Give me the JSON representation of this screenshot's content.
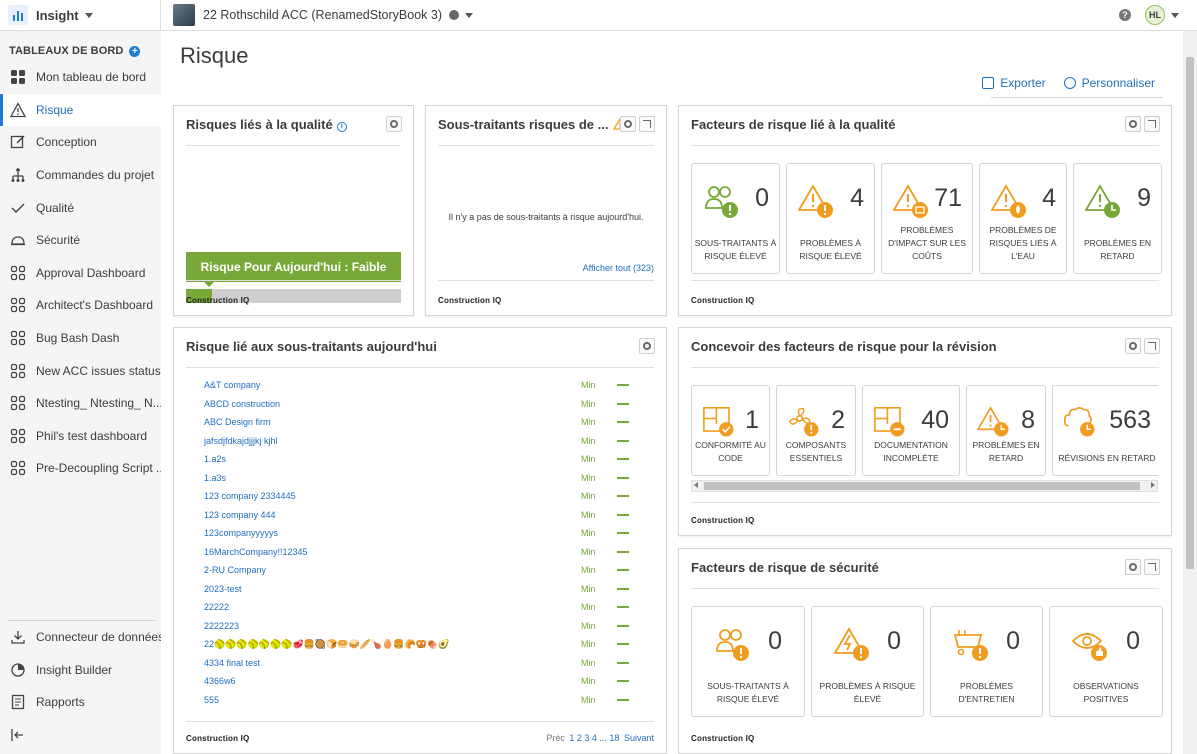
{
  "topbar": {
    "app_name": "Insight",
    "project_name": "22 Rothschild ACC (RenamedStoryBook 3)",
    "help_icon": "?",
    "avatar_initials": "HL"
  },
  "sidebar": {
    "header": "TABLEAUX DE BORD",
    "plus": "+",
    "items": [
      {
        "label": "Mon tableau de bord",
        "icon": "grid-icon"
      },
      {
        "label": "Risque",
        "icon": "warning-icon"
      },
      {
        "label": "Conception",
        "icon": "edit-icon"
      },
      {
        "label": "Commandes du projet",
        "icon": "hierarchy-icon"
      },
      {
        "label": "Qualité",
        "icon": "check-icon"
      },
      {
        "label": "Sécurité",
        "icon": "hardhat-icon"
      },
      {
        "label": "Approval Dashboard",
        "icon": "dashboard-icon"
      },
      {
        "label": "Architect's Dashboard",
        "icon": "dashboard-icon"
      },
      {
        "label": "Bug Bash Dash",
        "icon": "dashboard-icon"
      },
      {
        "label": "New ACC issues status...",
        "icon": "dashboard-icon"
      },
      {
        "label": "Ntesting_ Ntesting_ N...",
        "icon": "dashboard-icon"
      },
      {
        "label": "Phil's test dashboard",
        "icon": "dashboard-icon"
      },
      {
        "label": "Pre-Decoupling Script ...",
        "icon": "dashboard-icon"
      }
    ],
    "bottom_items": [
      {
        "label": "Connecteur de données",
        "icon": "download-icon"
      },
      {
        "label": "Insight Builder",
        "icon": "pie-chart-icon"
      },
      {
        "label": "Rapports",
        "icon": "report-icon"
      }
    ],
    "collapse_icon": "collapse-icon"
  },
  "page": {
    "title": "Risque",
    "export_label": "Exporter",
    "customize_label": "Personnaliser"
  },
  "cards": {
    "quality_risk": {
      "title": "Risques liés à la qualité",
      "banner": "Risque Pour Aujourd'hui : Faible",
      "level_fraction": 0.12,
      "footer": "Construction IQ"
    },
    "subcontractor_risk": {
      "title": "Sous-traitants risques de ...",
      "empty": "Il n'y a pas de sous-traitants à risque aujourd'hui.",
      "see_all": "Afficher tout (323)",
      "footer": "Construction IQ"
    },
    "quality_factors": {
      "title": "Facteurs de risque lié à la qualité",
      "tiles": [
        {
          "value": "0",
          "label": "SOUS-TRAITANTS À RISQUE ÉLEVÉ",
          "icon": "people-warning-icon"
        },
        {
          "value": "4",
          "label": "PROBLÈMES À RISQUE ÉLEVÉ",
          "icon": "triangle-warning-icon"
        },
        {
          "value": "71",
          "label": "PROBLÈMES D'IMPACT SUR LES COÛTS",
          "icon": "triangle-cost-icon"
        },
        {
          "value": "4",
          "label": "PROBLÈMES DE RISQUES LIÉS À L'EAU",
          "icon": "triangle-water-icon"
        },
        {
          "value": "9",
          "label": "PROBLÈMES EN RETARD",
          "icon": "triangle-clock-icon"
        }
      ],
      "footer": "Construction IQ"
    },
    "subs_today": {
      "title": "Risque lié aux sous-traitants aujourd'hui",
      "rows": [
        {
          "name": "A&T company",
          "level": "Min"
        },
        {
          "name": "ABCD construction",
          "level": "Min"
        },
        {
          "name": "ABC Design firm",
          "level": "Min"
        },
        {
          "name": "jafsdjfdkajdjjjkj kjhl",
          "level": "Min"
        },
        {
          "name": "1.a2s",
          "level": "Min"
        },
        {
          "name": "1.a3s",
          "level": "Min"
        },
        {
          "name": "123 company 2334445",
          "level": "Min"
        },
        {
          "name": "123 company 444",
          "level": "Min"
        },
        {
          "name": "123companyyyyys",
          "level": "Min"
        },
        {
          "name": "16MarchCompany!!12345",
          "level": "Min"
        },
        {
          "name": "2-RU Company",
          "level": "Min"
        },
        {
          "name": "2023-test",
          "level": "Min"
        },
        {
          "name": "22222",
          "level": "Min"
        },
        {
          "name": "2222223",
          "level": "Min"
        },
        {
          "name": "22🥎🥎🥎🥎🥎🥎🥎🥩🍔🥘🍞🥯🥪🥖🍗🥚🍔🥐🥨🍖🥑",
          "level": "Min"
        },
        {
          "name": "4334 final test",
          "level": "Min"
        },
        {
          "name": "4366w6",
          "level": "Min"
        },
        {
          "name": "555",
          "level": "Min"
        }
      ],
      "pager_prev": "Préc",
      "pager_pages": "1 2 3 4 ... 18",
      "pager_next": "Suivant",
      "footer": "Construction IQ"
    },
    "design_factors": {
      "title": "Concevoir des facteurs de risque pour la révision",
      "tiles": [
        {
          "value": "1",
          "label": "CONFORMITÉ AU CODE",
          "icon": "blueprint-check-icon"
        },
        {
          "value": "2",
          "label": "COMPOSANTS ESSENTIELS",
          "icon": "fan-warning-icon"
        },
        {
          "value": "40",
          "label": "DOCUMENTATION INCOMPLÈTE",
          "icon": "blueprint-minus-icon"
        },
        {
          "value": "8",
          "label": "PROBLÈMES EN RETARD",
          "icon": "triangle-clock-icon"
        },
        {
          "value": "563",
          "label": "RÉVISIONS EN RETARD",
          "icon": "cloud-clock-icon"
        }
      ],
      "footer": "Construction IQ"
    },
    "safety_factors": {
      "title": "Facteurs de risque de sécurité",
      "tiles": [
        {
          "value": "0",
          "label": "SOUS-TRAITANTS À RISQUE ÉLEVÉ",
          "icon": "people-warning-icon"
        },
        {
          "value": "0",
          "label": "PROBLÈMES À RISQUE ÉLEVÉ",
          "icon": "triangle-bolt-icon"
        },
        {
          "value": "0",
          "label": "PROBLÈMES D'ENTRETIEN",
          "icon": "cart-warning-icon"
        },
        {
          "value": "0",
          "label": "OBSERVATIONS POSITIVES",
          "icon": "eye-thumb-icon"
        }
      ],
      "footer": "Construction IQ"
    }
  },
  "colors": {
    "accent": "#1f7dd1",
    "link": "#1f6fbf",
    "risk_low": "#77a838",
    "icon_orange": "#f29c1f",
    "icon_green": "#77a838"
  }
}
